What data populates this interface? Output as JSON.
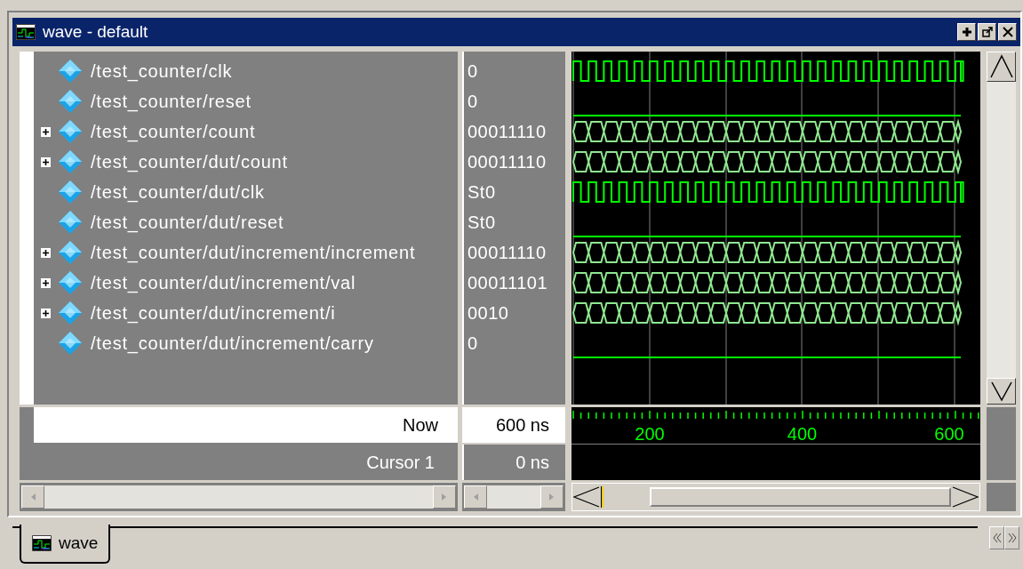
{
  "window": {
    "title": "wave - default"
  },
  "signals": [
    {
      "name": "/test_counter/clk",
      "value": "0",
      "kind": "clock",
      "expandable": false
    },
    {
      "name": "/test_counter/reset",
      "value": "0",
      "kind": "low",
      "expandable": false
    },
    {
      "name": "/test_counter/count",
      "value": "00011110",
      "kind": "bus",
      "expandable": true
    },
    {
      "name": "/test_counter/dut/count",
      "value": "00011110",
      "kind": "bus",
      "expandable": true
    },
    {
      "name": "/test_counter/dut/clk",
      "value": "St0",
      "kind": "clock",
      "expandable": false
    },
    {
      "name": "/test_counter/dut/reset",
      "value": "St0",
      "kind": "low",
      "expandable": false
    },
    {
      "name": "/test_counter/dut/increment/increment",
      "value": "00011110",
      "kind": "bus",
      "expandable": true
    },
    {
      "name": "/test_counter/dut/increment/val",
      "value": "00011101",
      "kind": "bus",
      "expandable": true
    },
    {
      "name": "/test_counter/dut/increment/i",
      "value": "0010",
      "kind": "bus",
      "expandable": true
    },
    {
      "name": "/test_counter/dut/increment/carry",
      "value": "0",
      "kind": "low",
      "expandable": false
    }
  ],
  "now": {
    "label": "Now",
    "value": "600 ns"
  },
  "cursor": {
    "label": "Cursor 1",
    "value": "0 ns"
  },
  "ruler": {
    "labels": [
      "200",
      "400",
      "600"
    ]
  },
  "tabs": [
    {
      "label": "wave",
      "selected": true
    }
  ]
}
